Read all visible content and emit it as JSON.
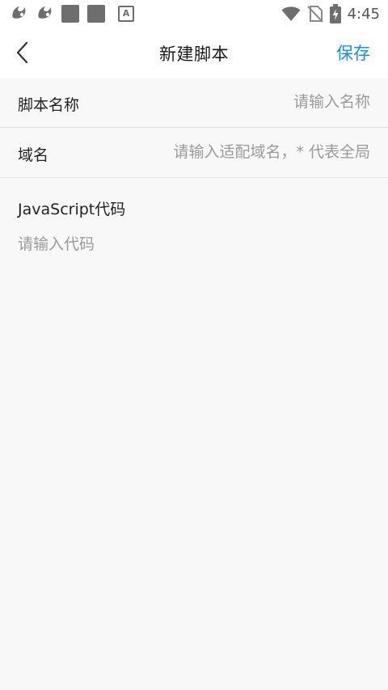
{
  "status_bar": {
    "time": "4:45",
    "left_icons": [
      "uc-browser-icon",
      "uc-browser-icon",
      "app-icon",
      "app-icon",
      "keyboard-a-icon"
    ],
    "right_icons": [
      "wifi-icon",
      "no-sim-icon",
      "battery-charging-icon"
    ]
  },
  "header": {
    "title": "新建脚本",
    "save_label": "保存"
  },
  "form": {
    "script_name": {
      "label": "脚本名称",
      "placeholder": "请输入名称",
      "value": ""
    },
    "domain": {
      "label": "域名",
      "placeholder": "请输入适配域名，* 代表全局",
      "value": ""
    },
    "code": {
      "label": "JavaScript代码",
      "placeholder": "请输入代码",
      "value": ""
    }
  },
  "colors": {
    "accent": "#1f8ce6",
    "background": "#f8f8f8",
    "header_background": "#ffffff",
    "divider": "#e3e3e3",
    "placeholder": "#9a9a9a"
  }
}
